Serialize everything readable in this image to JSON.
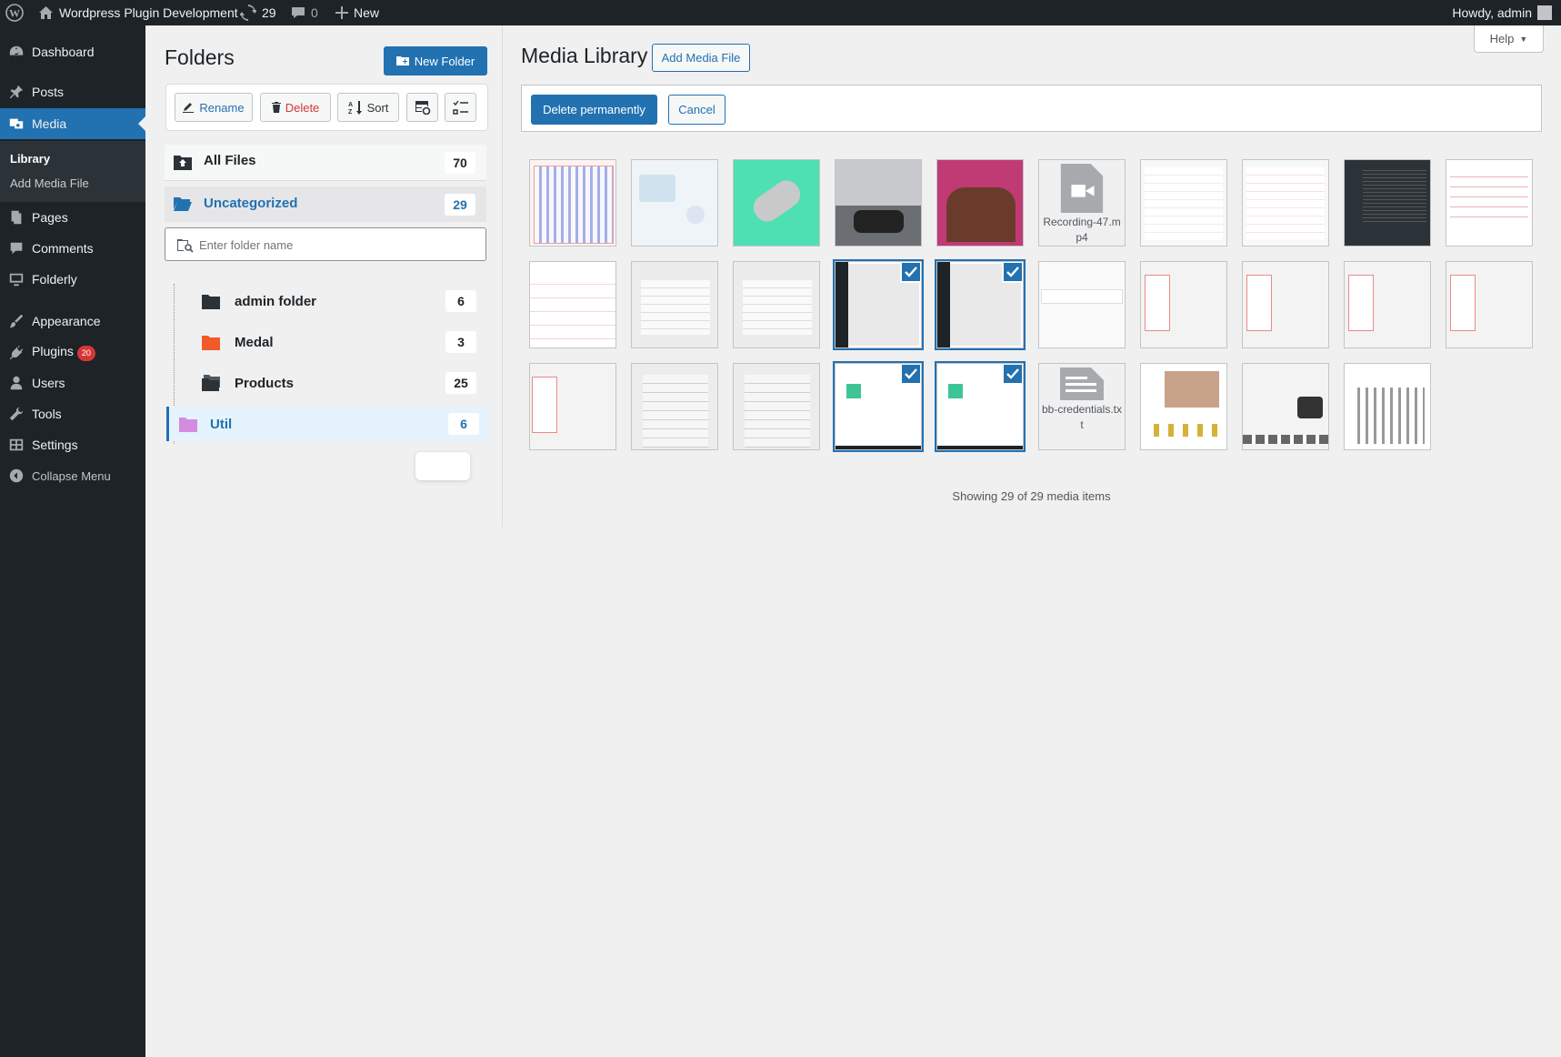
{
  "adminbar": {
    "site_name": "Wordpress Plugin Development",
    "updates_count": "29",
    "comments_count": "0",
    "new_label": "New",
    "howdy": "Howdy, admin"
  },
  "menu": {
    "dashboard": "Dashboard",
    "posts": "Posts",
    "media": "Media",
    "library": "Library",
    "add_media_file": "Add Media File",
    "pages": "Pages",
    "comments": "Comments",
    "folderly": "Folderly",
    "appearance": "Appearance",
    "plugins": "Plugins",
    "plugins_badge": "20",
    "users": "Users",
    "tools": "Tools",
    "settings": "Settings",
    "collapse": "Collapse Menu"
  },
  "folders": {
    "title": "Folders",
    "new_folder": "New Folder",
    "rename": "Rename",
    "delete": "Delete",
    "sort": "Sort",
    "search_placeholder": "Enter folder name",
    "all_files": {
      "label": "All Files",
      "count": "70"
    },
    "uncategorized": {
      "label": "Uncategorized",
      "count": "29"
    },
    "tree": [
      {
        "label": "admin folder",
        "count": "6",
        "color": "#2c3338"
      },
      {
        "label": "Medal",
        "count": "3",
        "color": "#f25a29"
      },
      {
        "label": "Products",
        "count": "25",
        "color": "#2c3338"
      },
      {
        "label": "Util",
        "count": "6",
        "color": "#d38ce0"
      }
    ]
  },
  "media": {
    "title": "Media Library",
    "add_button": "Add Media File",
    "help": "Help",
    "delete_permanently": "Delete permanently",
    "cancel": "Cancel",
    "recording_name": "Recording-47.mp4",
    "credentials_name": "bb-credentials.txt",
    "showing": "Showing 29 of 29 media items"
  },
  "colors": {
    "accent": "#2271b1",
    "sidebar_bg": "#1d2327",
    "delete_red": "#d63638"
  }
}
